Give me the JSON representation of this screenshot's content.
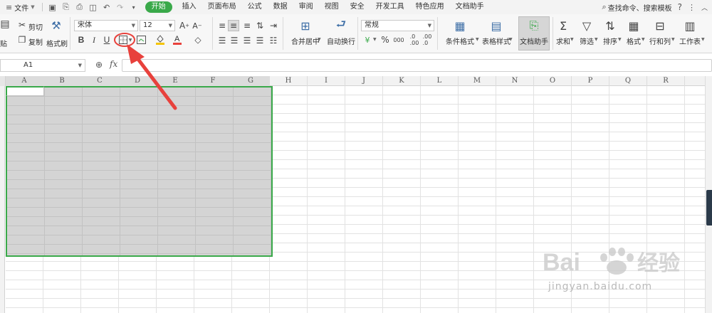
{
  "menubar": {
    "file_label": "文件",
    "tabs": [
      "开始",
      "插入",
      "页面布局",
      "公式",
      "数据",
      "审阅",
      "视图",
      "安全",
      "开发工具",
      "特色应用",
      "文档助手"
    ],
    "active_tab": "开始",
    "search_label": "查找命令、搜索模板",
    "help_label": "?"
  },
  "ribbon": {
    "paste_label": "贴",
    "cut_label": "剪切",
    "copy_label": "复制",
    "format_painter_label": "格式刷",
    "font_name": "宋体",
    "font_size": "12",
    "bold_label": "B",
    "italic_label": "I",
    "underline_label": "U",
    "merge_center_label": "合并居中",
    "wrap_text_label": "自动换行",
    "number_format": "常规",
    "percent_label": "%",
    "thousands_label": "000",
    "conditional_format_label": "条件格式",
    "table_style_label": "表格样式",
    "doc_helper_label": "文档助手",
    "sum_label": "求和",
    "filter_label": "筛选",
    "sort_label": "排序",
    "format_label": "格式",
    "row_col_label": "行和列",
    "worksheet_label": "工作表"
  },
  "formula_bar": {
    "name_box": "A1",
    "fx_label": "fx"
  },
  "grid": {
    "columns": [
      "A",
      "B",
      "C",
      "D",
      "E",
      "F",
      "G",
      "H",
      "I",
      "J",
      "K",
      "L",
      "M",
      "N",
      "O",
      "P",
      "Q",
      "R"
    ],
    "selected_range": "A1:G18"
  },
  "colors": {
    "accent": "#3aa94a",
    "selection_fill": "#d4d4d4",
    "annotation": "#e8413c"
  },
  "watermark": {
    "text": "jingyan.baidu.com"
  }
}
